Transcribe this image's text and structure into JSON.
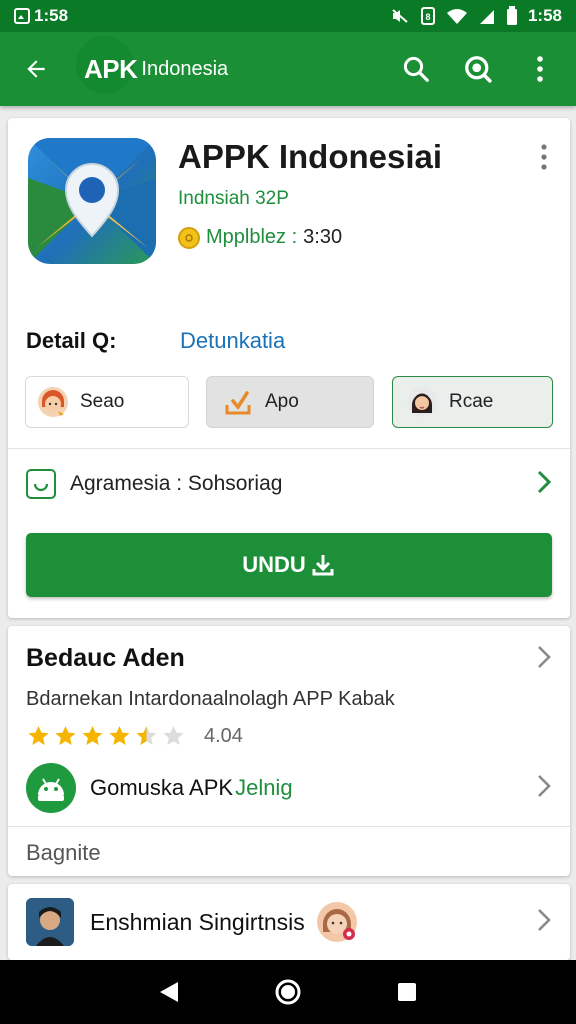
{
  "status_bar": {
    "left_text": "1:58",
    "time": "1:58",
    "icons": [
      "photo-icon",
      "mute-icon",
      "nfc-icon",
      "wifi-icon",
      "signal-icon",
      "battery-icon"
    ]
  },
  "app_bar": {
    "logo_text": "APK",
    "brand_name": "Indonesia",
    "icons": [
      "back-arrow-icon",
      "search-icon",
      "search-focus-icon",
      "more-vert-icon"
    ]
  },
  "app": {
    "title": "APPK Indonesiai",
    "developer": "Indnsiah 32P",
    "meta_key": "Mpplblez :",
    "meta_value": "3:30",
    "detail_label": "Detail Q:",
    "detail_link": "Detunkatia",
    "chips": [
      {
        "label": "Seao",
        "icon": "avatar-girl-icon"
      },
      {
        "label": "Apo",
        "icon": "download-tray-icon"
      },
      {
        "label": "Rcae",
        "icon": "avatar-woman-icon"
      }
    ],
    "agreement": "Agramesia : Sohsoriag",
    "download_label": "UNDU"
  },
  "related": {
    "title": "Bedauc Aden",
    "description": "Bdarnekan Intardonaalnolagh APP Kabak",
    "rating": "4.04",
    "rating_fraction": 0.81,
    "app_name": "Gomuska APK",
    "app_tag": "Jelnig",
    "footer": "Bagnite"
  },
  "developer_row": {
    "name": "Enshmian Singirtnsis"
  },
  "colors": {
    "primary": "#1a8f35",
    "status_bar": "#0b7a27",
    "accent_green": "#1f8f3d",
    "link_blue": "#1b72b8",
    "star": "#f4b400"
  },
  "nav_bar": {
    "icons": [
      "back-triangle-icon",
      "home-circle-icon",
      "recents-square-icon"
    ]
  }
}
